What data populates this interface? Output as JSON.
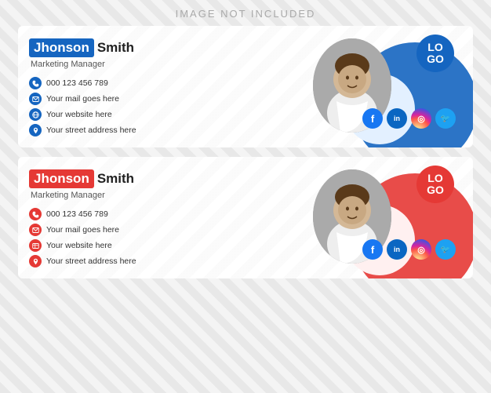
{
  "watermark": "IMAGE NOT INCLUDED",
  "cards": [
    {
      "id": "blue-card",
      "accentColor": "#1565C0",
      "accentColorLight": "#1976D2",
      "firstName": "Jhonson",
      "lastName": "Smith",
      "title": "Marketing Manager",
      "contacts": [
        {
          "icon": "phone",
          "text": "000 123 456 789"
        },
        {
          "icon": "mail",
          "text": "Your mail goes here"
        },
        {
          "icon": "web",
          "text": "Your website here"
        },
        {
          "icon": "location",
          "text": "Your street address here"
        }
      ],
      "logo": "LO\nGO",
      "social": [
        "f",
        "in",
        "◎",
        "🐦"
      ]
    },
    {
      "id": "red-card",
      "accentColor": "#e53935",
      "accentColorLight": "#ef5350",
      "firstName": "Jhonson",
      "lastName": "Smith",
      "title": "Marketing Manager",
      "contacts": [
        {
          "icon": "phone",
          "text": "000 123 456 789"
        },
        {
          "icon": "mail",
          "text": "Your mail goes here"
        },
        {
          "icon": "web",
          "text": "Your website here"
        },
        {
          "icon": "location",
          "text": "Your street address here"
        }
      ],
      "logo": "LO\nGO",
      "social": [
        "f",
        "in",
        "◎",
        "🐦"
      ]
    }
  ]
}
